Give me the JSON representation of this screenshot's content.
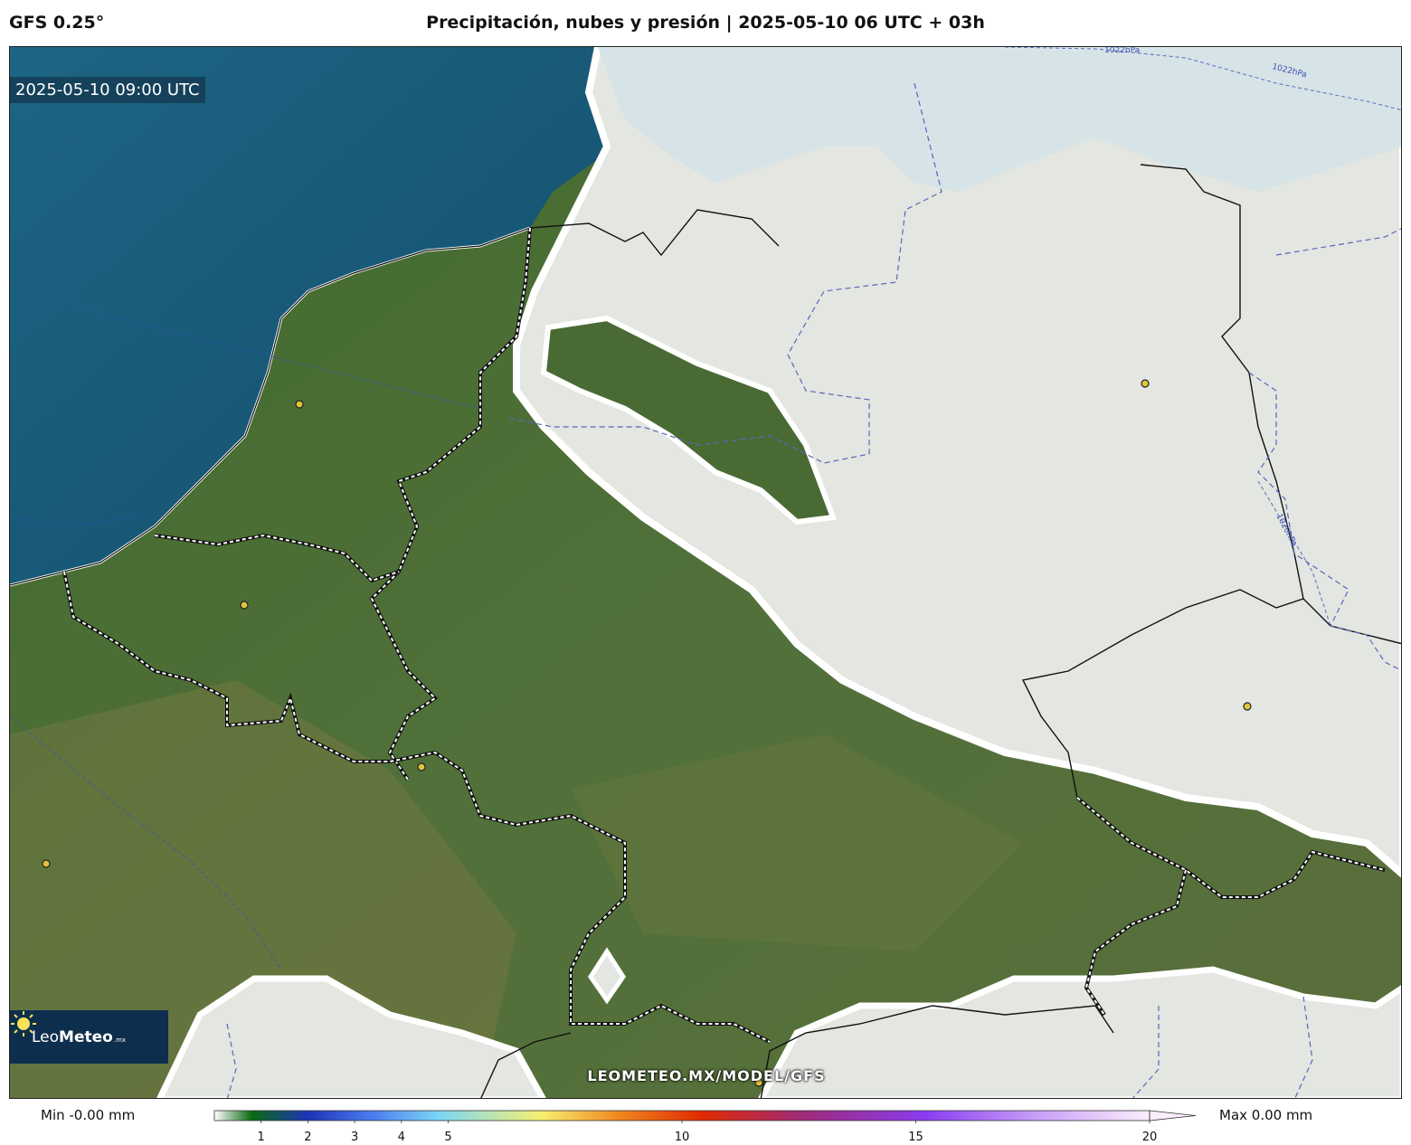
{
  "header": {
    "model": "GFS 0.25°",
    "title": "Precipitación, nubes y presión | 2025-05-10 06 UTC + 03h"
  },
  "map": {
    "valid_time": "2025-05-10 09:00 UTC",
    "watermark": "LEOMETEO.MX/MODEL/GFS",
    "isobars": [
      "1022hPa",
      "1022hPa",
      "1020hPa"
    ],
    "colors": {
      "sea": "#1f6a8a",
      "land": "#4f6b34",
      "cloud": "#e2e5df",
      "isobar": "#3a4fb0"
    }
  },
  "logo": {
    "brand_light": "Leo",
    "brand_bold": "Meteo",
    "domain": ".mx"
  },
  "legend": {
    "min_label": "Min -0.00 mm",
    "max_label": "Max 0.00 mm",
    "range": [
      0,
      20
    ],
    "ticks": [
      "1",
      "2",
      "3",
      "4",
      "5",
      "10",
      "15",
      "20"
    ],
    "tick_values": [
      1,
      2,
      3,
      4,
      5,
      10,
      15,
      20
    ],
    "colors": [
      "#ffffff",
      "#0a6a10",
      "#1c34b8",
      "#4d7cf0",
      "#7ad7f5",
      "#f8f070",
      "#f08a20",
      "#e02a00",
      "#9e2a7a",
      "#8a3cf0",
      "#c8a0f8",
      "#fbeefb"
    ]
  }
}
